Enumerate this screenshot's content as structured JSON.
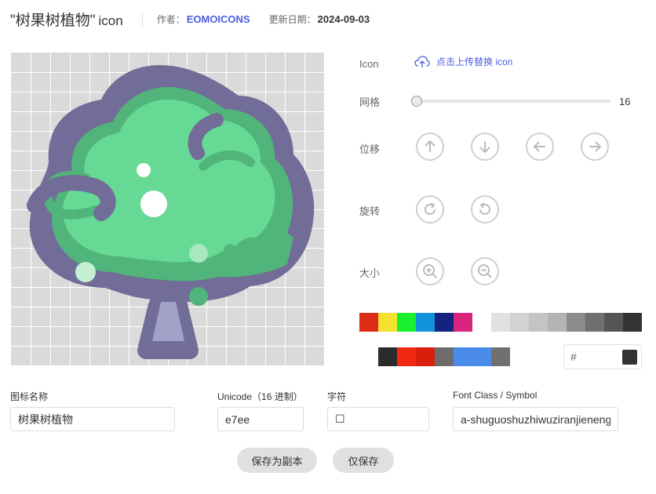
{
  "header": {
    "title": "\"树果树植物\"",
    "title_suffix": "icon",
    "author_label": "作者：",
    "author": "EOMOICONS",
    "date_label": "更新日期：",
    "date": "2024-09-03"
  },
  "controls": {
    "icon_label": "Icon",
    "upload_label": "点击上传替换 icon",
    "grid_label": "网格",
    "grid_value": "16",
    "move_label": "位移",
    "rotate_label": "旋转",
    "size_label": "大小",
    "hash": "#"
  },
  "palette_row1": [
    "#dd2c16",
    "#f5e22e",
    "#1bf02e",
    "#1493dd",
    "#13237f",
    "#d8237f"
  ],
  "palette_row2": [
    "#e1e1e1",
    "#d2d2d2",
    "#c4c4c4",
    "#b4b4b4",
    "#8b8b8b",
    "#707070",
    "#555555",
    "#333333"
  ],
  "palette_row3": [
    "#2b2b2b",
    "#f02813",
    "#d91f0c",
    "#6c6c6c",
    "#4a8ce8",
    "#4a8ce8",
    "#707070"
  ],
  "current_color": "#333333",
  "fields": {
    "name_label": "图标名称",
    "name_value": "树果树植物",
    "unicode_label": "Unicode（16 进制）",
    "unicode_value": "e7ee",
    "char_label": "字符",
    "char_value": "☐",
    "class_label": "Font Class / Symbol",
    "class_value": "a-shuguoshuzhiwuziranjieneng"
  },
  "buttons": {
    "save_copy": "保存为副本",
    "save_only": "仅保存"
  },
  "icon_colors": {
    "outline": "#716c98",
    "foliage_light": "#66da94",
    "foliage_dark": "#51b47a",
    "trunk": "#a2a1c7",
    "highlight": "#ffffff"
  }
}
